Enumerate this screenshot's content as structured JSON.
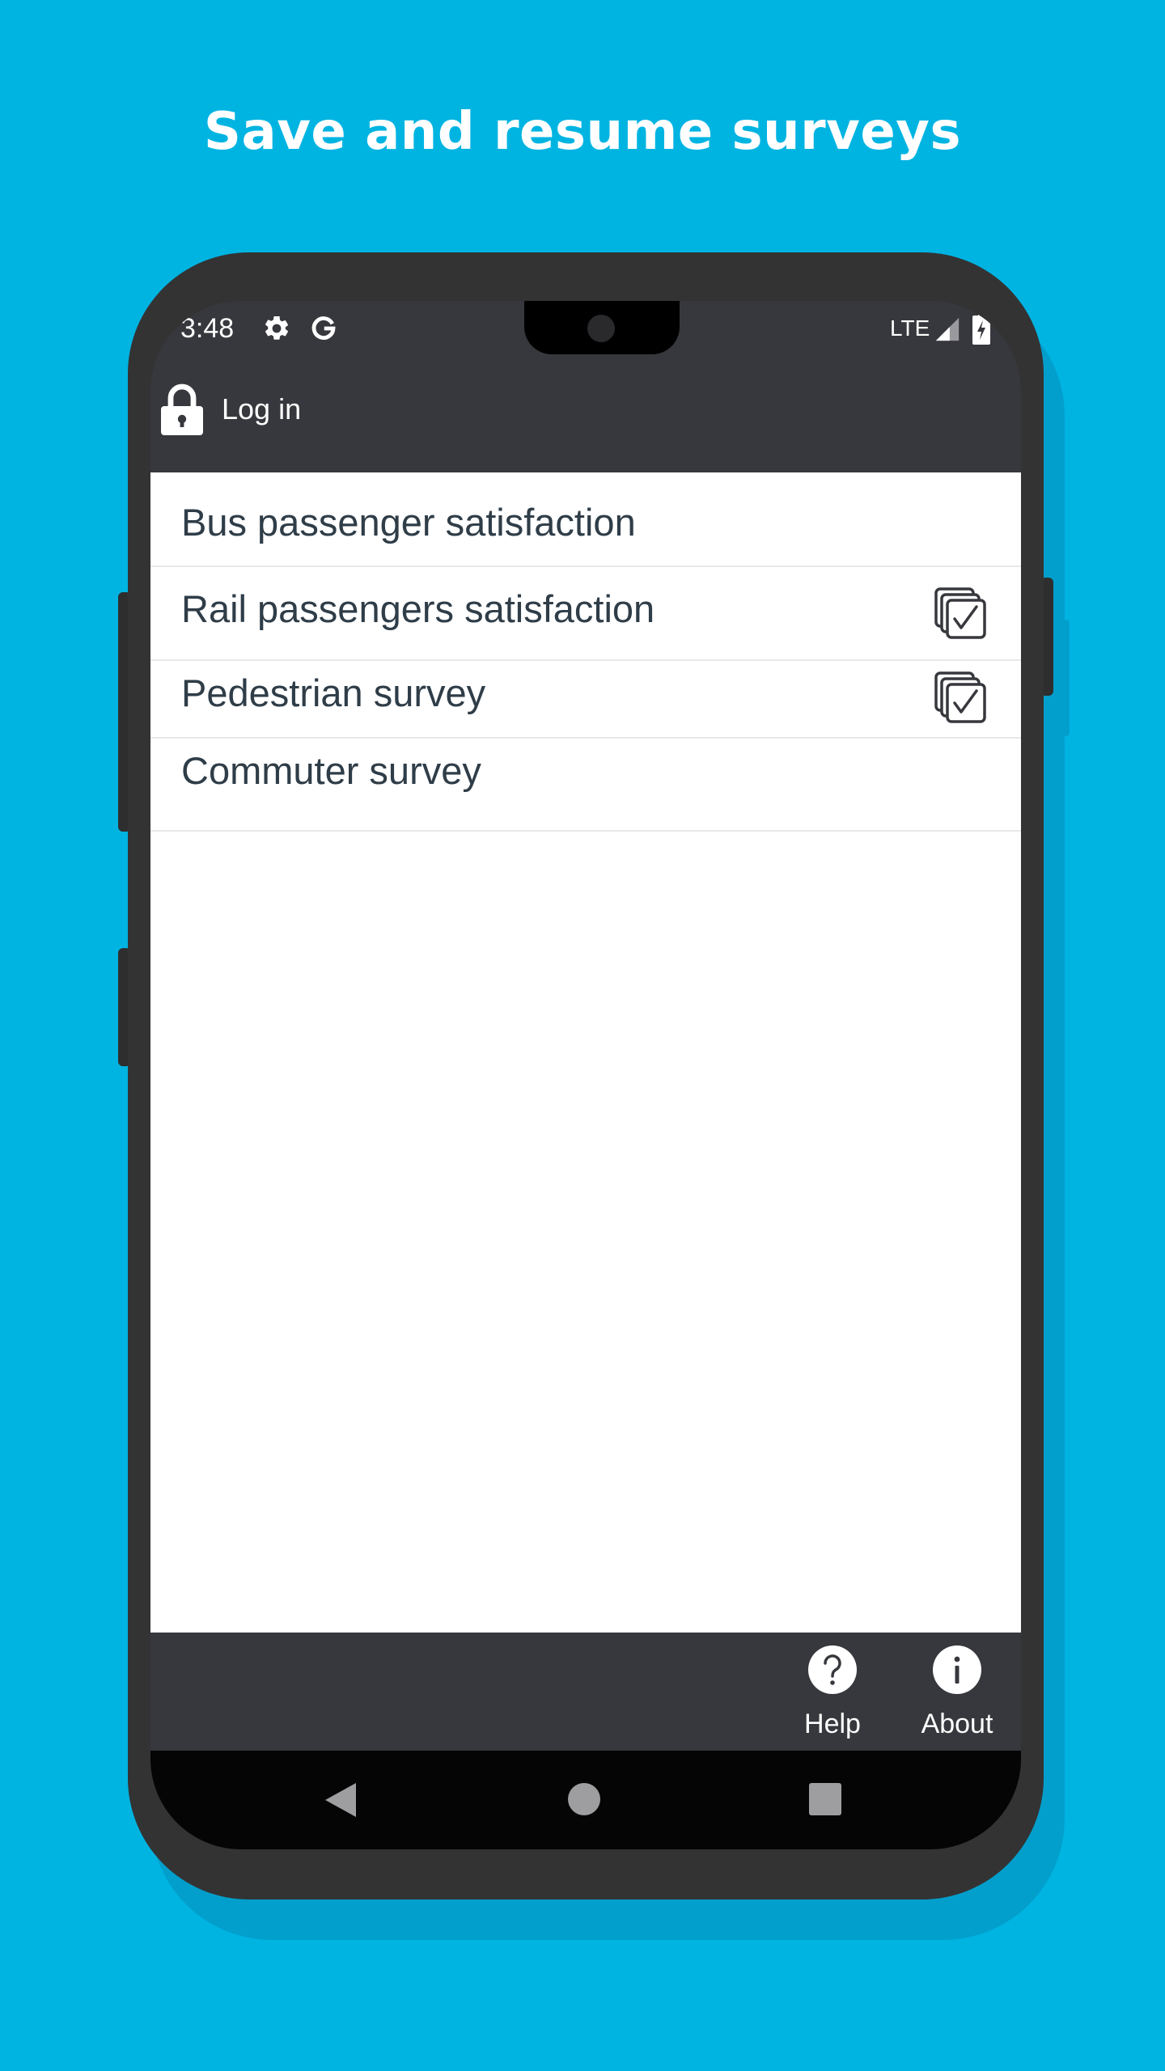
{
  "headline": "Save and resume surveys",
  "status_bar": {
    "time": "3:48",
    "network": "LTE",
    "icons": [
      "settings-icon",
      "google-icon",
      "signal-icon",
      "battery-charging-icon"
    ]
  },
  "appbar": {
    "login_label": "Log in",
    "login_icon": "lock-icon"
  },
  "surveys": [
    {
      "label": "Bus passenger satisfaction",
      "saved_responses_icon": false
    },
    {
      "label": "Rail passengers satisfaction",
      "saved_responses_icon": true
    },
    {
      "label": "Pedestrian survey",
      "saved_responses_icon": true
    },
    {
      "label": "Commuter survey",
      "saved_responses_icon": false
    }
  ],
  "bottom_bar": {
    "help_label": "Help",
    "about_label": "About"
  },
  "nav": [
    "back",
    "home",
    "recents"
  ],
  "colors": {
    "background": "#00b4e2",
    "phone_body": "#333334",
    "app_bar": "#37383d",
    "list_text": "#2f3d48"
  }
}
